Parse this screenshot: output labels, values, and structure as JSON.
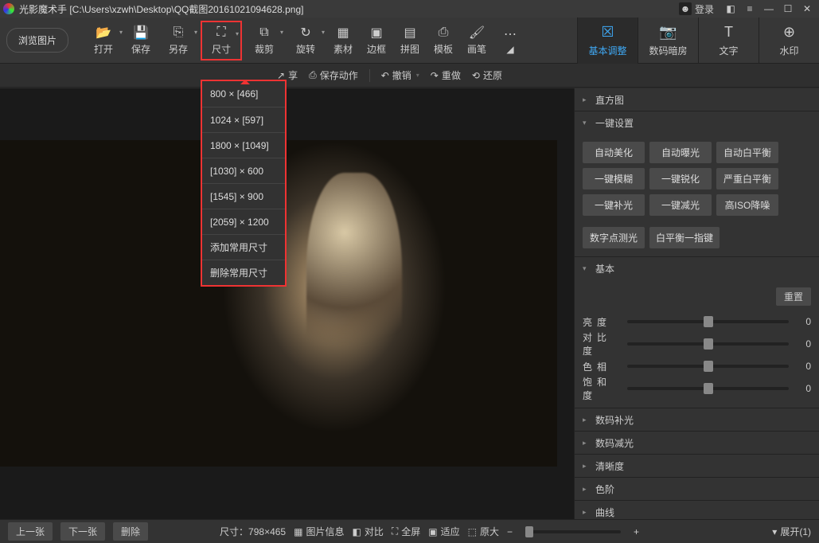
{
  "title": "光影魔术手  [C:\\Users\\xzwh\\Desktop\\QQ截图20161021094628.png]",
  "login_label": "登录",
  "browse_label": "浏览图片",
  "tools": {
    "open": "打开",
    "save": "保存",
    "saveas": "另存",
    "size": "尺寸",
    "crop": "裁剪",
    "rotate": "旋转",
    "material": "素材",
    "border": "边框",
    "collage": "拼图",
    "template": "模板",
    "brush": "画笔"
  },
  "rtabs": {
    "basic": "基本调整",
    "darkroom": "数码暗房",
    "text": "文字",
    "watermark": "水印"
  },
  "subbar": {
    "share": "享",
    "save_action": "保存动作",
    "undo": "撤销",
    "redo": "重做",
    "restore": "还原"
  },
  "size_menu": [
    "800 × [466]",
    "1024 × [597]",
    "1800 × [1049]",
    "[1030] × 600",
    "[1545] × 900",
    "[2059] × 1200",
    "添加常用尺寸",
    "删除常用尺寸"
  ],
  "panel": {
    "histogram": "直方图",
    "oneclick": "一键设置",
    "oneclick_btns": [
      "自动美化",
      "自动曝光",
      "自动白平衡",
      "一键模糊",
      "一键锐化",
      "严重白平衡",
      "一键补光",
      "一键减光",
      "高ISO降噪",
      "数字点测光",
      "白平衡一指键"
    ],
    "basic": "基本",
    "reset": "重置",
    "sliders": [
      {
        "label": "亮度",
        "val": "0"
      },
      {
        "label": "对比度",
        "val": "0"
      },
      {
        "label": "色相",
        "val": "0"
      },
      {
        "label": "饱和度",
        "val": "0"
      }
    ],
    "sections": [
      "数码补光",
      "数码减光",
      "清晰度",
      "色阶",
      "曲线"
    ]
  },
  "bottom": {
    "prev": "上一张",
    "next": "下一张",
    "del": "删除",
    "dims": "尺寸：798×465",
    "info": "图片信息",
    "compare": "对比",
    "fullscreen": "全屏",
    "fit": "适应",
    "orig": "原大",
    "expand": "展开(1)"
  }
}
